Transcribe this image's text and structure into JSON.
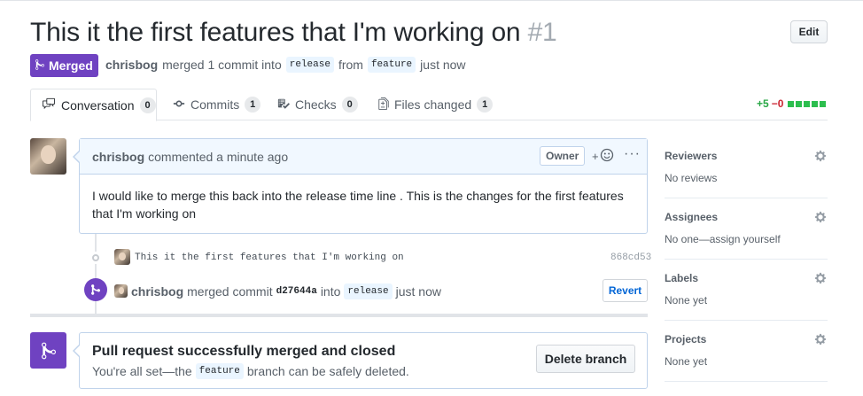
{
  "pr": {
    "title": "This it the first features that I'm working on",
    "number": "#1",
    "edit_label": "Edit",
    "state_label": "Merged",
    "meta": {
      "author": "chrisbog",
      "action": "merged 1 commit into",
      "base_branch": "release",
      "from_word": "from",
      "head_branch": "feature",
      "time": "just now"
    }
  },
  "tabs": [
    {
      "label": "Conversation",
      "count": "0"
    },
    {
      "label": "Commits",
      "count": "1"
    },
    {
      "label": "Checks",
      "count": "0"
    },
    {
      "label": "Files changed",
      "count": "1"
    }
  ],
  "diffstat": {
    "additions": "+5",
    "deletions": "−0"
  },
  "comment": {
    "author": "chrisbog",
    "header_text": "commented a minute ago",
    "owner_label": "Owner",
    "reaction_plus": "+",
    "more": "···",
    "body": "I would like to merge this back into the release time line . This is the changes for the first features that I'm working on"
  },
  "commit": {
    "message": "This it the first features that I'm working on",
    "sha": "868cd53"
  },
  "merge_event": {
    "author": "chrisbog",
    "text1": "merged commit",
    "sha": "d27644a",
    "into": "into",
    "branch": "release",
    "time": "just now",
    "revert_label": "Revert"
  },
  "merged_box": {
    "title": "Pull request successfully merged and closed",
    "sub_before": "You're all set—the",
    "branch": "feature",
    "sub_after": "branch can be safely deleted.",
    "delete_label": "Delete branch"
  },
  "sidebar": [
    {
      "title": "Reviewers",
      "value": "No reviews"
    },
    {
      "title": "Assignees",
      "value": "No one—assign yourself"
    },
    {
      "title": "Labels",
      "value": "None yet"
    },
    {
      "title": "Projects",
      "value": "None yet"
    }
  ],
  "colors": {
    "merged_purple": "#6f42c1",
    "link_blue": "#0366d6",
    "add_green": "#28a745",
    "del_red": "#cb2431"
  }
}
